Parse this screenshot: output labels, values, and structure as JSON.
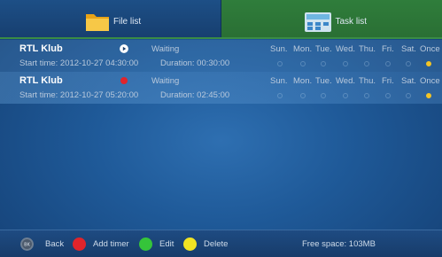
{
  "tabs": {
    "file_list": "File list",
    "task_list": "Task list"
  },
  "day_headers": [
    "Sun.",
    "Mon.",
    "Tue.",
    "Wed.",
    "Thu.",
    "Fri.",
    "Sat.",
    "Once"
  ],
  "tasks": [
    {
      "channel": "RTL Klub",
      "status": "Waiting",
      "status_icon": "play-icon",
      "start_label": "Start time: 2012-10-27  04:30:00",
      "duration_label": "Duration: 00:30:00",
      "days": [
        false,
        false,
        false,
        false,
        false,
        false,
        false,
        true
      ]
    },
    {
      "channel": "RTL Klub",
      "status": "Waiting",
      "status_icon": "record-icon",
      "start_label": "Start time: 2012-10-27  05:20:00",
      "duration_label": "Duration: 02:45:00",
      "days": [
        false,
        false,
        false,
        false,
        false,
        false,
        false,
        true
      ]
    }
  ],
  "footer": {
    "back_label": "Back",
    "add_timer_label": "Add timer",
    "edit_label": "Edit",
    "delete_label": "Delete",
    "free_space": "Free space: 103MB",
    "colors": {
      "red": "#e0242b",
      "green": "#35c43a",
      "yellow": "#f1e323"
    }
  }
}
